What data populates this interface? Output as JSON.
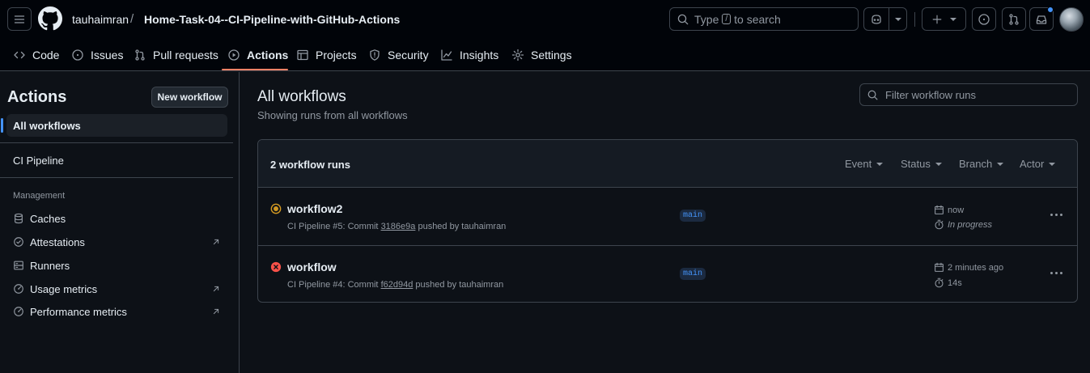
{
  "header": {
    "owner": "tauhaimran",
    "separator": "/",
    "repo": "Home-Task-04--CI-Pipeline-with-GitHub-Actions",
    "search_prefix": "Type",
    "search_key": "/",
    "search_suffix": "to search"
  },
  "tabs": [
    {
      "label": "Code",
      "icon": "code-icon"
    },
    {
      "label": "Issues",
      "icon": "issue-icon"
    },
    {
      "label": "Pull requests",
      "icon": "pull-request-icon"
    },
    {
      "label": "Actions",
      "icon": "play-icon",
      "active": true
    },
    {
      "label": "Projects",
      "icon": "table-icon"
    },
    {
      "label": "Security",
      "icon": "shield-icon"
    },
    {
      "label": "Insights",
      "icon": "graph-icon"
    },
    {
      "label": "Settings",
      "icon": "gear-icon"
    }
  ],
  "sidebar": {
    "title": "Actions",
    "new_workflow": "New workflow",
    "all_workflows": "All workflows",
    "workflow_item": "CI Pipeline",
    "group_label": "Management",
    "management": [
      {
        "label": "Caches",
        "icon": "database-icon",
        "external": false
      },
      {
        "label": "Attestations",
        "icon": "verified-icon",
        "external": true
      },
      {
        "label": "Runners",
        "icon": "server-icon",
        "external": false
      },
      {
        "label": "Usage metrics",
        "icon": "meter-icon",
        "external": true
      },
      {
        "label": "Performance metrics",
        "icon": "meter-icon",
        "external": true
      }
    ]
  },
  "main": {
    "title": "All workflows",
    "subtitle": "Showing runs from all workflows",
    "filter_placeholder": "Filter workflow runs",
    "runs_count": "2 workflow runs",
    "filters": [
      "Event",
      "Status",
      "Branch",
      "Actor"
    ],
    "runs": [
      {
        "name": "workflow2",
        "status": "in-progress",
        "meta_prefix": "CI Pipeline #5: Commit",
        "sha": "3186e9a",
        "meta_suffix": "pushed by tauhaimran",
        "branch": "main",
        "when": "now",
        "duration": "In progress"
      },
      {
        "name": "workflow",
        "status": "failed",
        "meta_prefix": "CI Pipeline #4: Commit",
        "sha": "f62d94d",
        "meta_suffix": "pushed by tauhaimran",
        "branch": "main",
        "when": "2 minutes ago",
        "duration": "14s"
      }
    ]
  },
  "colors": {
    "accent": "#4493f8",
    "underline": "#f78166",
    "in_progress": "#d29922",
    "failed": "#f85149"
  }
}
